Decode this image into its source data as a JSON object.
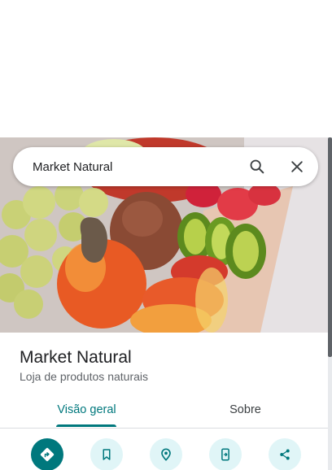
{
  "search": {
    "value": "Market Natural",
    "search_icon": "search-icon",
    "clear_icon": "close-icon"
  },
  "place": {
    "name": "Market Natural",
    "category": "Loja de produtos naturais"
  },
  "tabs": [
    {
      "label": "Visão geral",
      "active": true
    },
    {
      "label": "Sobre",
      "active": false
    }
  ],
  "actions": [
    {
      "icon": "directions-icon"
    },
    {
      "icon": "bookmark-icon"
    },
    {
      "icon": "nearby-location-icon"
    },
    {
      "icon": "send-to-phone-icon"
    },
    {
      "icon": "share-icon"
    }
  ],
  "colors": {
    "accent": "#00787d",
    "action_bg": "#e0f5f7",
    "text": "#202124",
    "secondary_text": "#5f6368"
  }
}
